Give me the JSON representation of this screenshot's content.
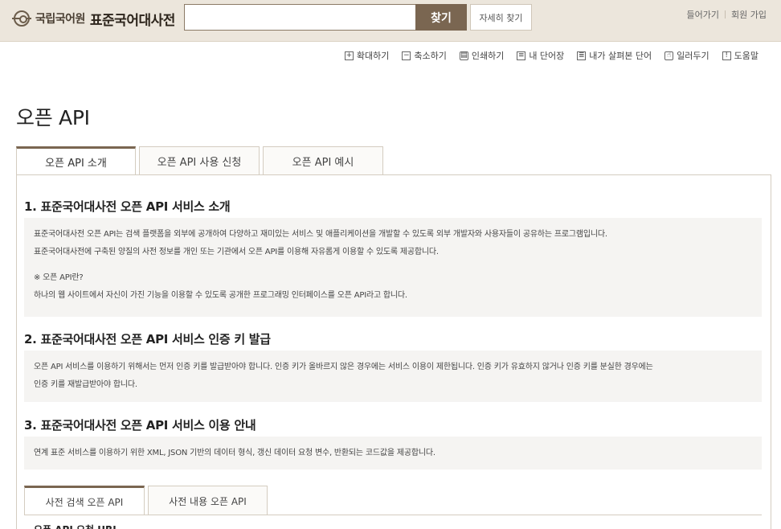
{
  "header": {
    "logo_org": "국립국어원",
    "logo_title": "표준국어대사전",
    "search_value": "",
    "search_button": "찾기",
    "advanced_button": "자세히 찾기",
    "login": "들어가기",
    "signup": "회원 가입"
  },
  "toolbar": {
    "zoom_in": "확대하기",
    "zoom_out": "축소하기",
    "print": "인쇄하기",
    "my_words": "내 단어장",
    "history": "내가 살펴본 단어",
    "notice": "일러두기",
    "help": "도움말"
  },
  "page": {
    "title": "오픈 API"
  },
  "tabs": [
    {
      "label": "오픈 API 소개",
      "active": true
    },
    {
      "label": "오픈 API 사용 신청",
      "active": false
    },
    {
      "label": "오픈 API 예시",
      "active": false
    }
  ],
  "sections": [
    {
      "heading": "1. 표준국어대사전 오픈 API 서비스 소개",
      "lines": [
        "표준국어대사전 오픈 API는 검색 플랫폼을 외부에 공개하여 다양하고 재미있는 서비스 및 애플리케이션을 개발할 수 있도록 외부 개발자와 사용자들이 공유하는 프로그램입니다.",
        "표준국어대사전에 구축된 양질의 사전 정보를 개인 또는 기관에서 오픈 API를 이용해 자유롭게 이용할 수 있도록 제공합니다.",
        "※ 오픈 API란?",
        "하나의 웹 사이트에서 자신이 가진 기능을 이용할 수 있도록 공개한 프로그래밍 인터페이스를 오픈 API라고 합니다."
      ]
    },
    {
      "heading": "2. 표준국어대사전 오픈 API 서비스 인증 키 발급",
      "lines": [
        "오픈 API 서비스를 이용하기 위해서는 먼저 인증 키를 발급받아야 합니다. 인증 키가 올바르지 않은 경우에는 서비스 이용이 제한됩니다. 인증 키가 유효하지 않거나 인증 키를 분실한 경우에는",
        "인증 키를 재발급받아야 합니다."
      ]
    },
    {
      "heading": "3. 표준국어대사전 오픈 API 서비스 이용 안내",
      "lines": [
        "연계 표준 서비스를 이용하기 위한 XML, JSON 기반의 데이터 형식, 갱신 데이터 요청 변수, 반환되는 코드값을 제공합니다."
      ]
    }
  ],
  "subtabs": [
    {
      "label": "사전 검색 오픈 API",
      "active": true
    },
    {
      "label": "사전 내용 오픈 API",
      "active": false
    }
  ],
  "cut_heading": "오픈 API 요청 URL"
}
